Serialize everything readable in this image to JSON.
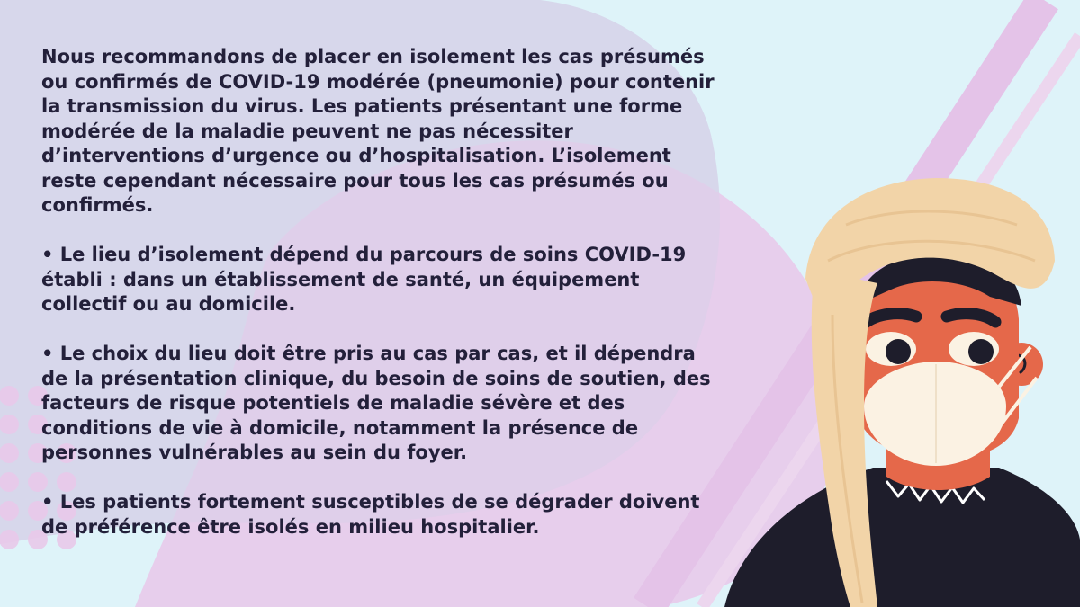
{
  "slide": {
    "paragraphs": [
      "Nous recommandons de placer en isolement les cas présumés ou confirmés de COVID-19 modérée (pneumonie) pour contenir la transmission du virus. Les patients présentant une forme modérée de la maladie peuvent ne pas nécessiter d’interventions d’urgence ou d’hospitalisation. L’isolement reste cependant nécessaire pour tous les cas présumés ou confirmés.",
      "• Le lieu d’isolement dépend du parcours de soins COVID-19 établi : dans un établissement de santé, un équipement collectif ou au domicile.",
      "• Le choix du lieu doit être pris au cas par cas, et il dépendra de la présentation clinique, du besoin de soins de soutien, des facteurs de risque potentiels de maladie sévère et des conditions de vie à domicile, notamment la présence de personnes vulnérables au sein du foyer.",
      "• Les patients fortement susceptibles de se dégrader doivent de préférence être isolés en milieu hospitalier."
    ]
  },
  "colors": {
    "background": "#def3f9",
    "blob_lavender": "#d7d7ec",
    "blob_pink": "#e9c7ea",
    "text": "#23203a",
    "turban": "#f2d4a8",
    "skin": "#e5684a",
    "shirt": "#1e1d2b",
    "mask": "#fbf2e3"
  },
  "illustration": {
    "figure": "masked-man-in-turban",
    "icons": [
      "face-mask-icon"
    ]
  }
}
